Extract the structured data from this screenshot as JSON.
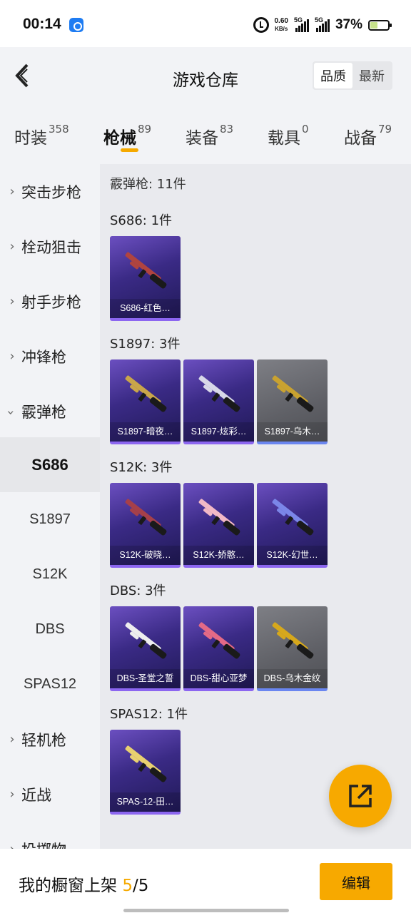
{
  "status_bar": {
    "time": "00:14",
    "net_speed_value": "0.60",
    "net_speed_unit": "KB/s",
    "sim1": "5G",
    "sim2": "5G",
    "battery": "37%"
  },
  "header": {
    "title": "游戏仓库",
    "sort_options": [
      "品质",
      "最新"
    ],
    "active_sort": "品质"
  },
  "tabs": [
    {
      "label": "时装",
      "count": "358"
    },
    {
      "label": "枪械",
      "count": "89",
      "active": true
    },
    {
      "label": "装备",
      "count": "83"
    },
    {
      "label": "载具",
      "count": "0"
    },
    {
      "label": "战备",
      "count": "79"
    }
  ],
  "sidebar": {
    "items": [
      {
        "label": "突击步枪",
        "type": "category",
        "expanded": false
      },
      {
        "label": "栓动狙击",
        "type": "category",
        "expanded": false
      },
      {
        "label": "射手步枪",
        "type": "category",
        "expanded": false
      },
      {
        "label": "冲锋枪",
        "type": "category",
        "expanded": false
      },
      {
        "label": "霰弹枪",
        "type": "category",
        "expanded": true
      },
      {
        "label": "S686",
        "type": "sub",
        "active": true
      },
      {
        "label": "S1897",
        "type": "sub"
      },
      {
        "label": "S12K",
        "type": "sub"
      },
      {
        "label": "DBS",
        "type": "sub"
      },
      {
        "label": "SPAS12",
        "type": "sub"
      },
      {
        "label": "轻机枪",
        "type": "category",
        "expanded": false
      },
      {
        "label": "近战",
        "type": "category",
        "expanded": false
      },
      {
        "label": "投掷物",
        "type": "category",
        "expanded": false
      }
    ]
  },
  "content": {
    "header": "霰弹枪: 11件",
    "groups": [
      {
        "title": "S686: 1件",
        "items": [
          {
            "label": "S686-红色…",
            "rarity": "purple",
            "skin": "#b0443f"
          }
        ]
      },
      {
        "title": "S1897: 3件",
        "items": [
          {
            "label": "S1897-暗夜…",
            "rarity": "purple",
            "skin": "#c9a54a"
          },
          {
            "label": "S1897-炫彩…",
            "rarity": "purple",
            "skin": "#d8d8e8"
          },
          {
            "label": "S1897-乌木…",
            "rarity": "grey",
            "skin": "#c9a230"
          }
        ]
      },
      {
        "title": "S12K: 3件",
        "items": [
          {
            "label": "S12K-破晓…",
            "rarity": "purple",
            "skin": "#a6404a"
          },
          {
            "label": "S12K-娇憨…",
            "rarity": "purple",
            "skin": "#f2b9c6"
          },
          {
            "label": "S12K-幻世…",
            "rarity": "purple",
            "skin": "#7b86e8"
          }
        ]
      },
      {
        "title": "DBS: 3件",
        "items": [
          {
            "label": "DBS-圣堂之誓",
            "rarity": "purple",
            "skin": "#eeeeee"
          },
          {
            "label": "DBS-甜心亚梦",
            "rarity": "purple",
            "skin": "#e46a86"
          },
          {
            "label": "DBS-乌木金纹",
            "rarity": "grey",
            "skin": "#d6a81c"
          }
        ]
      },
      {
        "title": "SPAS12: 1件",
        "items": [
          {
            "label": "SPAS-12-田…",
            "rarity": "purple",
            "skin": "#e8d070"
          }
        ]
      }
    ]
  },
  "fab": {
    "icon": "share-external-icon"
  },
  "bottom_bar": {
    "shelf_label": "我的橱窗上架",
    "shelf_used": "5",
    "shelf_total": "/5",
    "edit_label": "编辑"
  },
  "colors": {
    "accent": "#f7a900",
    "card_purple": "#3a2a85",
    "card_grey": "#5f6066",
    "content_bg": "#e9eaee",
    "sidebar_bg": "#f2f3f6"
  }
}
